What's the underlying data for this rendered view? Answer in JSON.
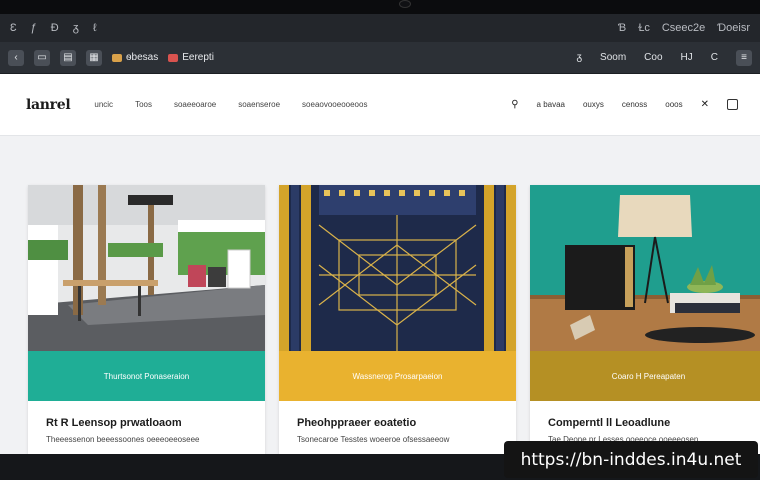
{
  "os_bar": {
    "left_items": [
      "Ɛ",
      "ƒ",
      "Ɖ",
      "ᵹ",
      "ℓ"
    ],
    "right_items": [
      "Ɓ",
      "Ɫc",
      "Cseec2e",
      "Ɗoeisr"
    ]
  },
  "browser": {
    "tab1_label": "ѳbesas",
    "tab2_label": "Eerepti",
    "right_items": [
      "ᵹ",
      "Soom",
      "Coo",
      "HJ",
      "C"
    ]
  },
  "site": {
    "logo": "lanrel",
    "nav": [
      "uncic",
      "Toos",
      "soaeeoaroe",
      "soaenseroe",
      "soeaovooeooeoos"
    ],
    "header_right": [
      "a bavaa",
      "ouxys",
      "cenoss",
      "ooos"
    ]
  },
  "cards": [
    {
      "band_label": "Thurtsonot Ponaseraion",
      "title": "Rt  R  Leensop prwatloaom",
      "subtitle": "Theeessenon beeessoones oeeeoeeoseee",
      "band_color": "#1fae96"
    },
    {
      "band_label": "Wassnerop Prosarpaeion",
      "title": "Pheohppraeer eoatetio",
      "subtitle": "Tsonecaroe Tesstes woeeroe ofsessaeeow",
      "band_color": "#e9b22f"
    },
    {
      "band_label": "Coaro H Pereapaten",
      "title": "Comperntl  ll  Leoadlune",
      "subtitle": "Tae Deone pr Lesses ooeeoce ooeeeosen",
      "band_color": "#b59024"
    }
  ],
  "watermark": "https://bn-inddes.in4u.net"
}
